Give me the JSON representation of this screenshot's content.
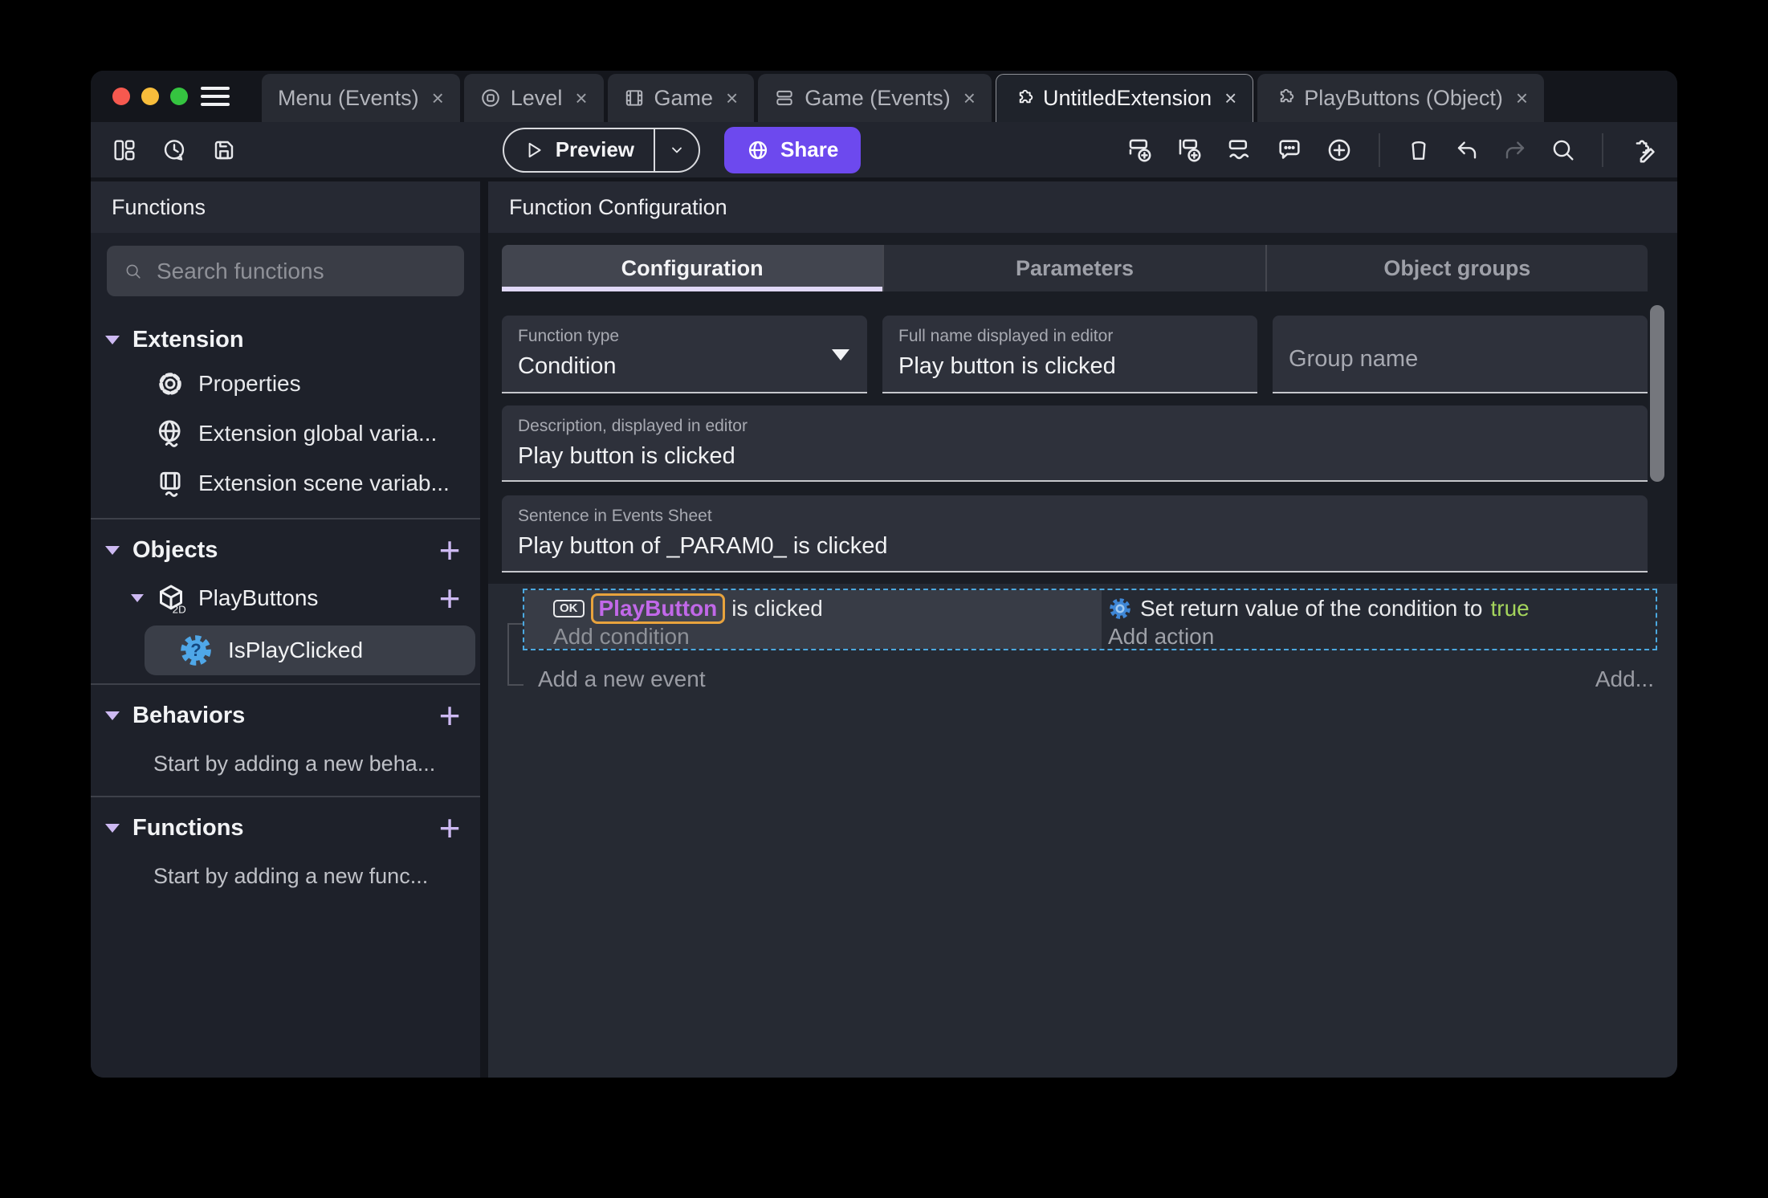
{
  "colors": {
    "accent_purple": "#6D49EE",
    "accent_lavender": "#CDB9F2",
    "selection_blue": "#4BA8DF",
    "object_name_purple": "#C168E8",
    "object_outline_orange": "#E8A33D",
    "boolean_true_green": "#A4D45C"
  },
  "tabbar": {
    "tabs": [
      {
        "label": "Menu (Events)",
        "close": "×"
      },
      {
        "label": "Level",
        "close": "×",
        "icon": "level-icon"
      },
      {
        "label": "Game",
        "close": "×",
        "icon": "film-icon"
      },
      {
        "label": "Game (Events)",
        "close": "×",
        "icon": "events-sheet-icon"
      },
      {
        "label": "UntitledExtension",
        "close": "×",
        "icon": "puzzle-icon",
        "active": true
      },
      {
        "label": "PlayButtons (Object)",
        "close": "×",
        "icon": "puzzle-icon"
      }
    ]
  },
  "toolbar": {
    "preview_label": "Preview",
    "share_label": "Share",
    "icons": [
      "layout-icon",
      "history-icon",
      "save-icon",
      "add-event-icon",
      "add-subevent-icon",
      "add-other-event-icon",
      "comment-icon",
      "circle-plus-icon",
      "trash-icon",
      "undo-icon",
      "redo-icon",
      "search-icon",
      "extension-edit-icon"
    ]
  },
  "sidebar": {
    "title": "Functions",
    "search_placeholder": "Search functions",
    "extension": {
      "label": "Extension",
      "items": [
        {
          "label": "Properties",
          "icon": "gear-icon"
        },
        {
          "label": "Extension global varia...",
          "icon": "globe-variable-icon"
        },
        {
          "label": "Extension scene variab...",
          "icon": "scene-variable-icon"
        }
      ]
    },
    "objects": {
      "label": "Objects",
      "object": {
        "label": "PlayButtons",
        "badge": "2D",
        "icon": "cube-2d-icon"
      },
      "function": {
        "label": "IsPlayClicked",
        "glyph": "?",
        "icon": "function-gear-icon"
      }
    },
    "behaviors": {
      "label": "Behaviors",
      "empty": "Start by adding a new beha..."
    },
    "functions": {
      "label": "Functions",
      "empty": "Start by adding a new func..."
    }
  },
  "main": {
    "title": "Function Configuration",
    "tabs": [
      {
        "label": "Configuration",
        "active": true
      },
      {
        "label": "Parameters"
      },
      {
        "label": "Object groups"
      }
    ],
    "form": {
      "function_type": {
        "label": "Function type",
        "value": "Condition"
      },
      "full_name": {
        "label": "Full name displayed in editor",
        "value": "Play button is clicked"
      },
      "group_name": {
        "placeholder": "Group name"
      },
      "description": {
        "label": "Description, displayed in editor",
        "value": "Play button is clicked"
      },
      "sentence": {
        "label": "Sentence in Events Sheet",
        "value": "Play button of _PARAM0_ is clicked"
      }
    },
    "events": {
      "condition": {
        "object_badge": "OK",
        "object_name": "PlayButton",
        "text": "is clicked",
        "placeholder": "Add condition"
      },
      "action": {
        "text": "Set return value of the condition to",
        "value": "true",
        "placeholder": "Add action"
      },
      "add_event": "Add a new event",
      "add_button": "Add..."
    }
  }
}
